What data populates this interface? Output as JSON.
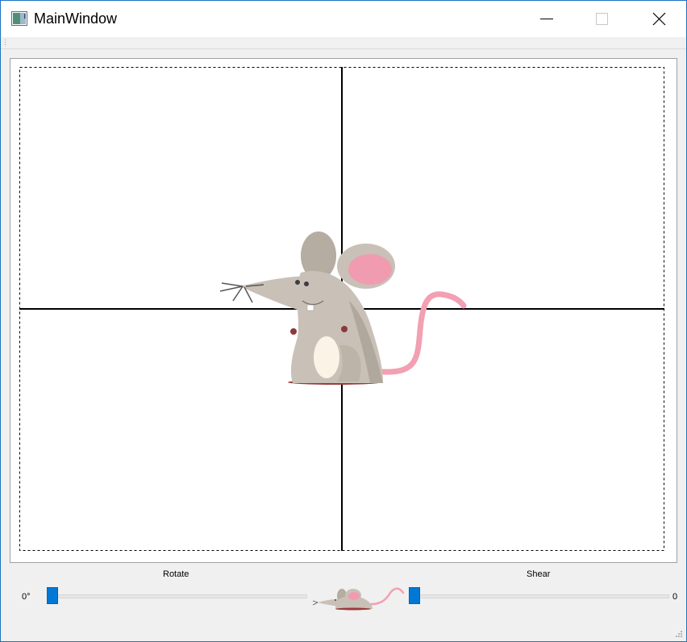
{
  "window": {
    "title": "MainWindow"
  },
  "controls": {
    "rotate_label": "Rotate",
    "shear_label": "Shear",
    "rotate_value": "0°",
    "shear_value": "0",
    "rotate_position": 0,
    "shear_position": 0
  },
  "colors": {
    "accent": "#0078d7",
    "mouse_body": "#c9c0b7",
    "mouse_ear_inner": "#f19bb0",
    "mouse_tail": "#f2a0b2"
  },
  "icons": [
    "app-icon",
    "minimize-icon",
    "maximize-icon",
    "close-icon",
    "toolbar-grip-icon",
    "size-grip-icon"
  ]
}
